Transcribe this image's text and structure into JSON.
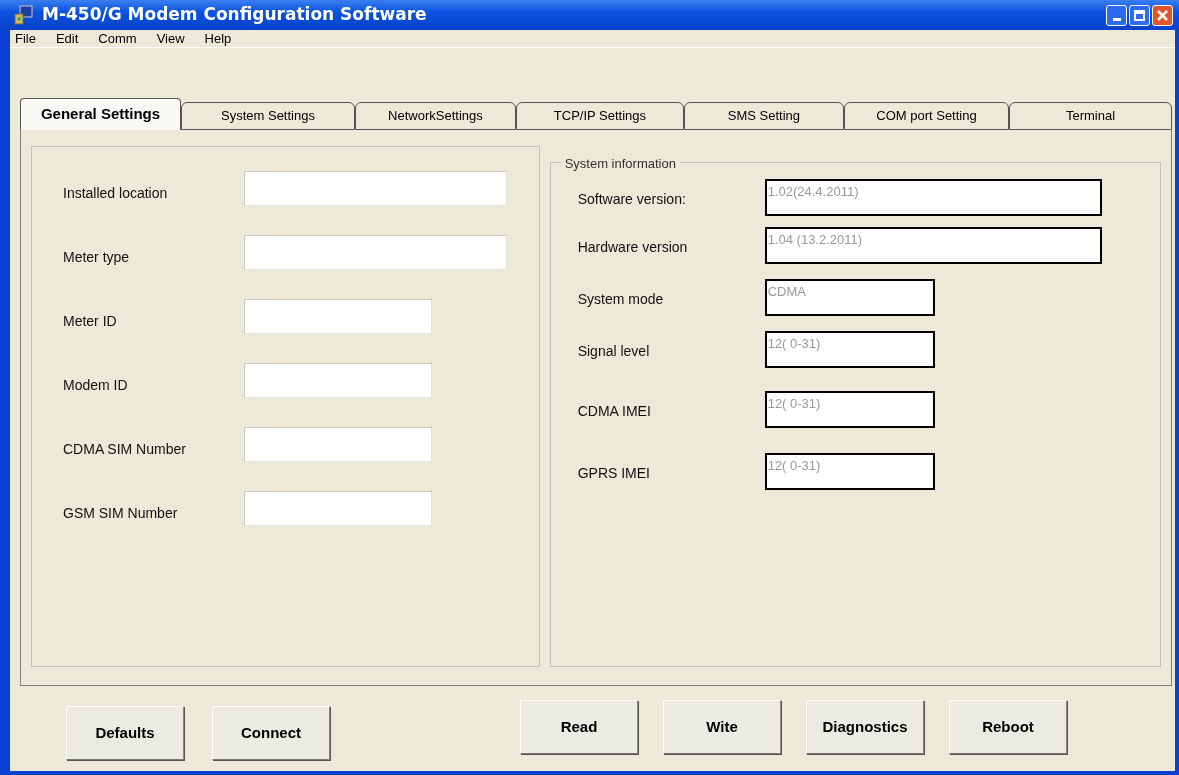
{
  "window": {
    "title": "M-450/G Modem Configuration Software"
  },
  "menu": [
    "File",
    "Edit",
    "Comm",
    "View",
    "Help"
  ],
  "tabs": [
    {
      "label": "General Settings",
      "selected": true
    },
    {
      "label": "System Settings",
      "selected": false
    },
    {
      "label": "NetworkSettings",
      "selected": false
    },
    {
      "label": "TCP/IP Settings",
      "selected": false
    },
    {
      "label": "SMS Setting",
      "selected": false
    },
    {
      "label": "COM port Setting",
      "selected": false
    },
    {
      "label": "Terminal",
      "selected": false
    }
  ],
  "general_fields": [
    {
      "label": "Installed location",
      "kind": "wide"
    },
    {
      "label": "Meter type",
      "kind": "wide"
    },
    {
      "label": "Meter ID",
      "kind": "short"
    },
    {
      "label": "Modem ID",
      "kind": "short"
    },
    {
      "label": "CDMA SIM Number",
      "kind": "short"
    },
    {
      "label": "GSM SIM Number",
      "kind": "short"
    }
  ],
  "system_information": {
    "title": "System information",
    "fields": [
      {
        "label": "Software version:",
        "value": "1.02(24.4.2011)",
        "kind": "wide",
        "disabled": true
      },
      {
        "label": "Hardware version",
        "value": "1.04 (13.2.2011)",
        "kind": "wide",
        "disabled": true
      },
      {
        "label": "System mode",
        "value": "CDMA",
        "kind": "short",
        "disabled": true
      },
      {
        "label": "Signal level",
        "value": "12( 0-31)",
        "kind": "short",
        "disabled": true
      },
      {
        "label": "CDMA IMEI",
        "value": "12( 0-31)",
        "kind": "short",
        "disabled": true
      },
      {
        "label": "GPRS IMEI",
        "value": "12( 0-31)",
        "kind": "short",
        "disabled": true
      }
    ]
  },
  "buttons_left": [
    "Defaults",
    "Connect"
  ],
  "buttons_right": [
    "Read",
    "Wite",
    "Diagnostics",
    "Reboot"
  ]
}
